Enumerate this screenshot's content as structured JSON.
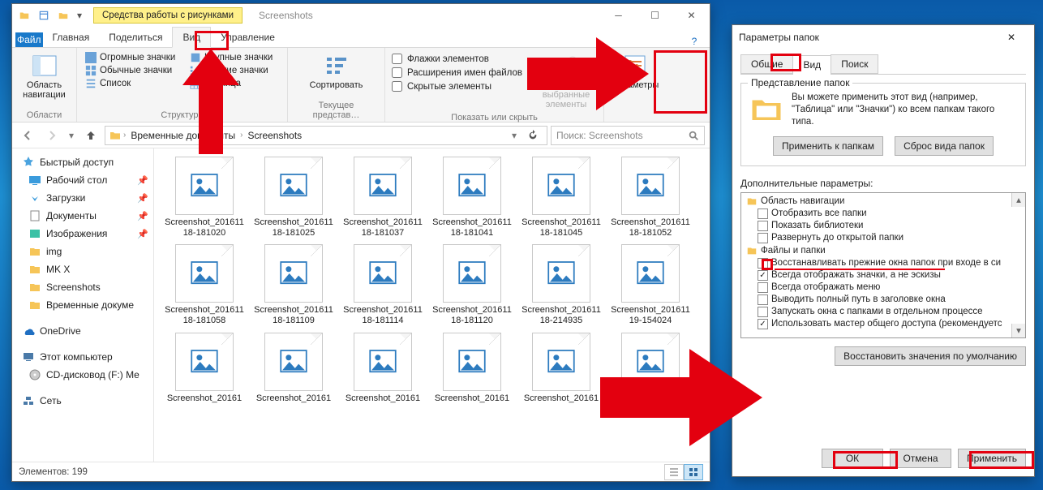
{
  "explorer": {
    "tools_tab": "Средства работы с рисунками",
    "title": "Screenshots",
    "tabs": {
      "file": "Файл",
      "home": "Главная",
      "share": "Поделиться",
      "view": "Вид",
      "manage": "Управление"
    },
    "ribbon": {
      "panes_btn": "Область навигации",
      "panes_group": "Области",
      "views": {
        "huge": "Огромные значки",
        "large": "Крупные значки",
        "normal": "Обычные значки",
        "small": "Мелкие значки",
        "list": "Список",
        "table": "Таблица"
      },
      "layout_group": "Структура",
      "sort_btn": "Сортировать",
      "current_view_group": "Текущее представ…",
      "checks": {
        "item_cb": "Флажки элементов",
        "ext": "Расширения имен файлов",
        "hidden": "Скрытые элементы"
      },
      "hide_btn_l1": "Скрыть выбранные",
      "hide_btn_l2": "элементы",
      "showhide_group": "Показать или скрыть",
      "options_btn": "Параметры"
    },
    "breadcrumb": {
      "a": "Временные документы",
      "b": "Screenshots"
    },
    "search_placeholder": "Поиск: Screenshots",
    "sidebar": {
      "quick": "Быстрый доступ",
      "desktop": "Рабочий стол",
      "downloads": "Загрузки",
      "documents": "Документы",
      "pictures": "Изображения",
      "img": "img",
      "mkx": "MK X",
      "screenshots": "Screenshots",
      "temp": "Временные докуме",
      "onedrive": "OneDrive",
      "thispc": "Этот компьютер",
      "cd": "CD-дисковод (F:) Me",
      "network": "Сеть"
    },
    "files": [
      "Screenshot_20161118-181020",
      "Screenshot_20161118-181025",
      "Screenshot_20161118-181037",
      "Screenshot_20161118-181041",
      "Screenshot_20161118-181045",
      "Screenshot_20161118-181052",
      "Screenshot_20161118-181058",
      "Screenshot_20161118-181109",
      "Screenshot_20161118-181114",
      "Screenshot_20161118-181120",
      "Screenshot_20161118-214935",
      "Screenshot_20161119-154024",
      "Screenshot_20161",
      "Screenshot_20161",
      "Screenshot_20161",
      "Screenshot_20161",
      "Screenshot_20161",
      "Screenshot_20161"
    ],
    "status": "Элементов: 199"
  },
  "dialog": {
    "title": "Параметры папок",
    "tabs": {
      "general": "Общие",
      "view": "Вид",
      "search": "Поиск"
    },
    "pres_legend": "Представление папок",
    "pres_text": "Вы можете применить этот вид (например, \"Таблица\" или \"Значки\") ко всем папкам такого типа.",
    "apply_folders": "Применить к папкам",
    "reset_folders": "Сброс вида папок",
    "adv_label": "Дополнительные параметры:",
    "tree": {
      "nav_area": "Область навигации",
      "show_all": "Отобразить все папки",
      "show_libs": "Показать библиотеки",
      "expand_open": "Развернуть до открытой папки",
      "files_folders": "Файлы и папки",
      "restore_prev": "Восстанавливать прежние окна папок при входе в си",
      "always_icons": "Всегда отображать значки, а не эскизы",
      "always_menu": "Всегда отображать меню",
      "full_path": "Выводить полный путь в заголовке окна",
      "separate_proc": "Запускать окна с папками в отдельном процессе",
      "use_wizard": "Использовать мастер общего доступа (рекомендуетс"
    },
    "restore_defaults": "Восстановить значения по умолчанию",
    "ok": "ОК",
    "cancel": "Отмена",
    "apply": "Применить"
  }
}
